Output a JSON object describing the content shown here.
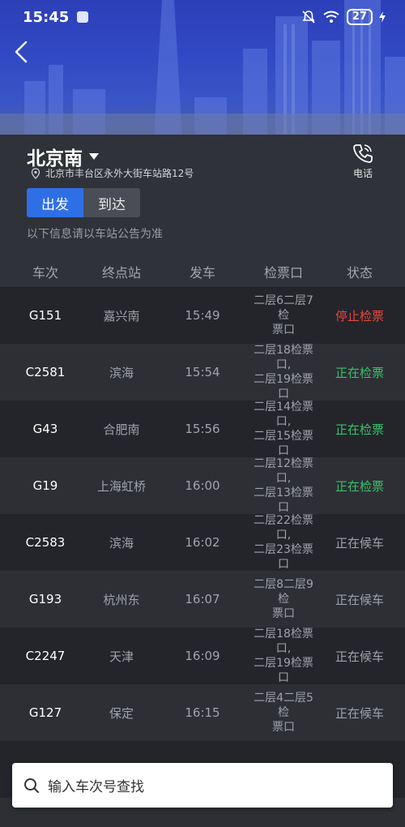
{
  "status_bar": {
    "time": "15:45",
    "battery": "27"
  },
  "station": {
    "name": "北京南",
    "address": "北京市丰台区永外大街车站路12号",
    "phone_label": "电话"
  },
  "tabs": {
    "depart": "出发",
    "arrive": "到达"
  },
  "notice": "以下信息请以车站公告为准",
  "table": {
    "headers": [
      "车次",
      "终点站",
      "发车",
      "检票口",
      "状态"
    ],
    "rows": [
      {
        "train": "G151",
        "dest": "嘉兴南",
        "time": "15:49",
        "gate1": "二层6二层7检",
        "gate2": "票口",
        "status": "停止检票",
        "status_color": "#e8473f"
      },
      {
        "train": "C2581",
        "dest": "滨海",
        "time": "15:54",
        "gate1": "二层18检票口,",
        "gate2": "二层19检票口",
        "status": "正在检票",
        "status_color": "#3cc06a"
      },
      {
        "train": "G43",
        "dest": "合肥南",
        "time": "15:56",
        "gate1": "二层14检票口,",
        "gate2": "二层15检票口",
        "status": "正在检票",
        "status_color": "#3cc06a"
      },
      {
        "train": "G19",
        "dest": "上海虹桥",
        "time": "16:00",
        "gate1": "二层12检票口,",
        "gate2": "二层13检票口",
        "status": "正在检票",
        "status_color": "#3cc06a"
      },
      {
        "train": "C2583",
        "dest": "滨海",
        "time": "16:02",
        "gate1": "二层22检票口,",
        "gate2": "二层23检票口",
        "status": "正在候车",
        "status_color": "#9ea1a8"
      },
      {
        "train": "G193",
        "dest": "杭州东",
        "time": "16:07",
        "gate1": "二层8二层9检",
        "gate2": "票口",
        "status": "正在候车",
        "status_color": "#9ea1a8"
      },
      {
        "train": "C2247",
        "dest": "天津",
        "time": "16:09",
        "gate1": "二层18检票口,",
        "gate2": "二层19检票口",
        "status": "正在候车",
        "status_color": "#9ea1a8"
      },
      {
        "train": "G127",
        "dest": "保定",
        "time": "16:15",
        "gate1": "二层4二层5检",
        "gate2": "票口",
        "status": "正在候车",
        "status_color": "#9ea1a8"
      }
    ]
  },
  "search": {
    "placeholder": "输入车次号查找"
  }
}
